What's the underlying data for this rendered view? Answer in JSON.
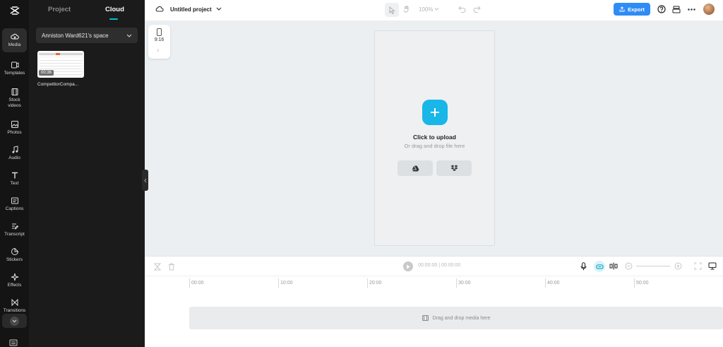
{
  "rail": {
    "items": [
      {
        "label": "Media",
        "icon": "cloud-upload-icon",
        "active": true
      },
      {
        "label": "Templates",
        "icon": "templates-icon"
      },
      {
        "label": "Stock videos",
        "icon": "film-icon"
      },
      {
        "label": "Photos",
        "icon": "image-icon"
      },
      {
        "label": "Audio",
        "icon": "music-note-icon"
      },
      {
        "label": "Text",
        "icon": "text-t-icon"
      },
      {
        "label": "Captions",
        "icon": "captions-icon"
      },
      {
        "label": "Transcript",
        "icon": "transcript-icon"
      },
      {
        "label": "Stickers",
        "icon": "sticker-icon"
      },
      {
        "label": "Effects",
        "icon": "sparkle-icon"
      },
      {
        "label": "Transitions",
        "icon": "bowtie-icon"
      }
    ]
  },
  "panel": {
    "tabs": [
      "Project",
      "Cloud"
    ],
    "space_name": "Anniston Ward621's space",
    "media": [
      {
        "name": "CompetitorCompa...",
        "duration": "00:36"
      }
    ]
  },
  "topbar": {
    "title": "Untitled project",
    "zoom": "100%",
    "export_label": "Export"
  },
  "canvas": {
    "ratio": "9:16",
    "upload_title": "Click to upload",
    "upload_sub": "Or drag and drop file here"
  },
  "timeline": {
    "current": "00:00:00",
    "total": "00:00:00",
    "ruler": [
      "00:00",
      "10:00",
      "20:00",
      "30:00",
      "40:00",
      "50:00"
    ],
    "drop_text": "Drag and drop media here"
  },
  "colors": {
    "accent": "#00c1cd",
    "export": "#2f8cf5",
    "upload": "#19b6e8"
  }
}
